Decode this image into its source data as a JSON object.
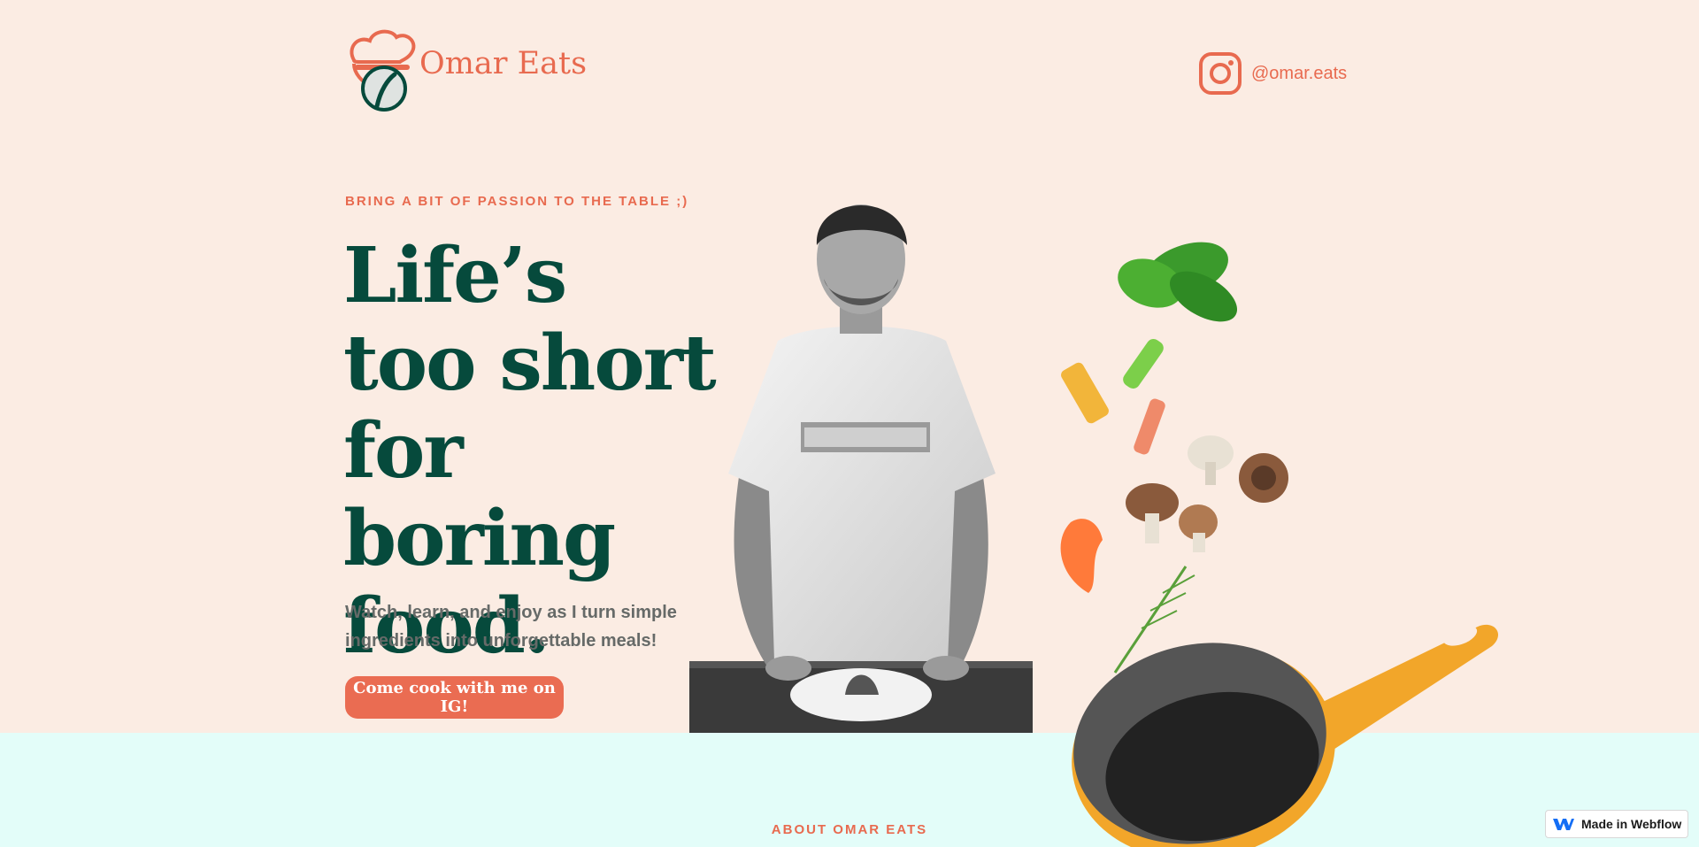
{
  "brand": {
    "name": "Omar Eats",
    "accent_color": "#e86a4f",
    "dark_green": "#064a3c",
    "hero_bg": "#fbece3",
    "about_bg": "#e3fdf9"
  },
  "header": {
    "instagram_handle": "@omar.eats",
    "instagram_icon": "instagram-icon"
  },
  "hero": {
    "kicker": "BRING A BIT OF PASSION TO THE TABLE ;)",
    "headline": "Life’s too short for boring food.",
    "subcopy": "Watch, learn, and enjoy as I turn simple ingredients into unforgettable meals!",
    "cta_label": "Come cook with me on IG!"
  },
  "about": {
    "label": "ABOUT OMAR EATS"
  },
  "badge": {
    "label": "Made in Webflow",
    "icon": "webflow-icon"
  }
}
